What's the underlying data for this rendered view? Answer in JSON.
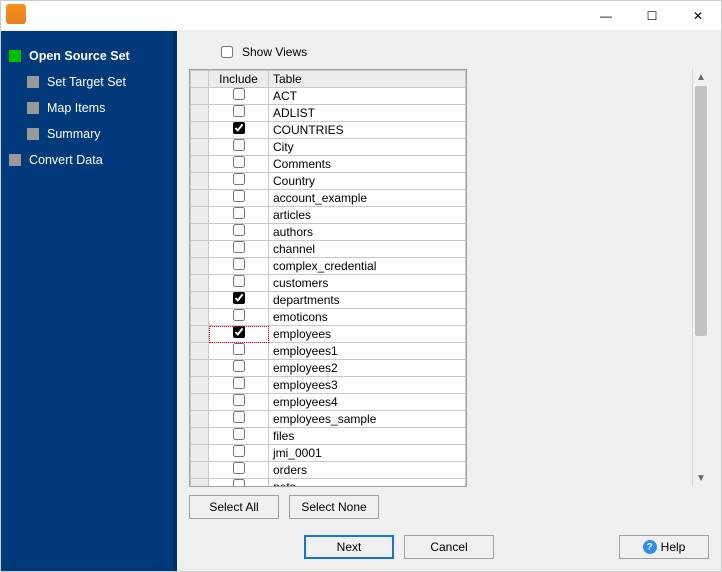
{
  "titlebar": {
    "min": "—",
    "max": "☐",
    "close": "✕"
  },
  "sidebar": {
    "items": [
      {
        "label": "Open Source Set",
        "active": true,
        "indent": false
      },
      {
        "label": "Set Target Set",
        "active": false,
        "indent": true
      },
      {
        "label": "Map Items",
        "active": false,
        "indent": true
      },
      {
        "label": "Summary",
        "active": false,
        "indent": true
      },
      {
        "label": "Convert Data",
        "active": false,
        "indent": false
      }
    ]
  },
  "show_views_label": "Show Views",
  "columns": {
    "include": "Include",
    "table": "Table"
  },
  "rows": [
    {
      "include": false,
      "table": "ACT"
    },
    {
      "include": false,
      "table": "ADLIST"
    },
    {
      "include": true,
      "table": "COUNTRIES"
    },
    {
      "include": false,
      "table": "City"
    },
    {
      "include": false,
      "table": "Comments"
    },
    {
      "include": false,
      "table": "Country"
    },
    {
      "include": false,
      "table": "account_example"
    },
    {
      "include": false,
      "table": "articles"
    },
    {
      "include": false,
      "table": "authors"
    },
    {
      "include": false,
      "table": "channel"
    },
    {
      "include": false,
      "table": "complex_credential"
    },
    {
      "include": false,
      "table": "customers"
    },
    {
      "include": true,
      "table": "departments"
    },
    {
      "include": false,
      "table": "emoticons"
    },
    {
      "include": true,
      "table": "employees",
      "focused": true
    },
    {
      "include": false,
      "table": "employees1"
    },
    {
      "include": false,
      "table": "employees2"
    },
    {
      "include": false,
      "table": "employees3"
    },
    {
      "include": false,
      "table": "employees4"
    },
    {
      "include": false,
      "table": "employees_sample"
    },
    {
      "include": false,
      "table": "files"
    },
    {
      "include": false,
      "table": "jmi_0001"
    },
    {
      "include": false,
      "table": "orders"
    },
    {
      "include": false,
      "table": "pets"
    }
  ],
  "buttons": {
    "select_all": "Select All",
    "select_none": "Select None",
    "next": "Next",
    "cancel": "Cancel",
    "help": "Help"
  }
}
